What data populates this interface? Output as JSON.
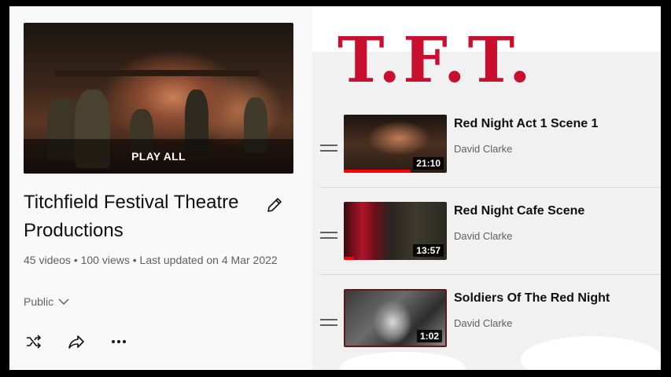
{
  "hero": {
    "overlay_label": "PLAY ALL"
  },
  "playlist": {
    "title": "Titchfield Festival Theatre Productions",
    "meta": "45 videos • 100 views • Last updated on 4 Mar 2022",
    "privacy": "Public",
    "actions": [
      "shuffle-icon",
      "share-icon",
      "more-icon"
    ]
  },
  "logo": {
    "text": "T.F.T.",
    "color": "#c8102e"
  },
  "videos": [
    {
      "title": "Red Night Act 1 Scene 1",
      "channel": "David Clarke",
      "duration": "21:10",
      "watched_fraction": 0.65
    },
    {
      "title": "Red Night Cafe Scene",
      "channel": "David Clarke",
      "duration": "13:57",
      "watched_fraction": 0.1
    },
    {
      "title": "Soldiers Of The Red Night",
      "channel": "David Clarke",
      "duration": "1:02",
      "watched_fraction": 0
    }
  ]
}
